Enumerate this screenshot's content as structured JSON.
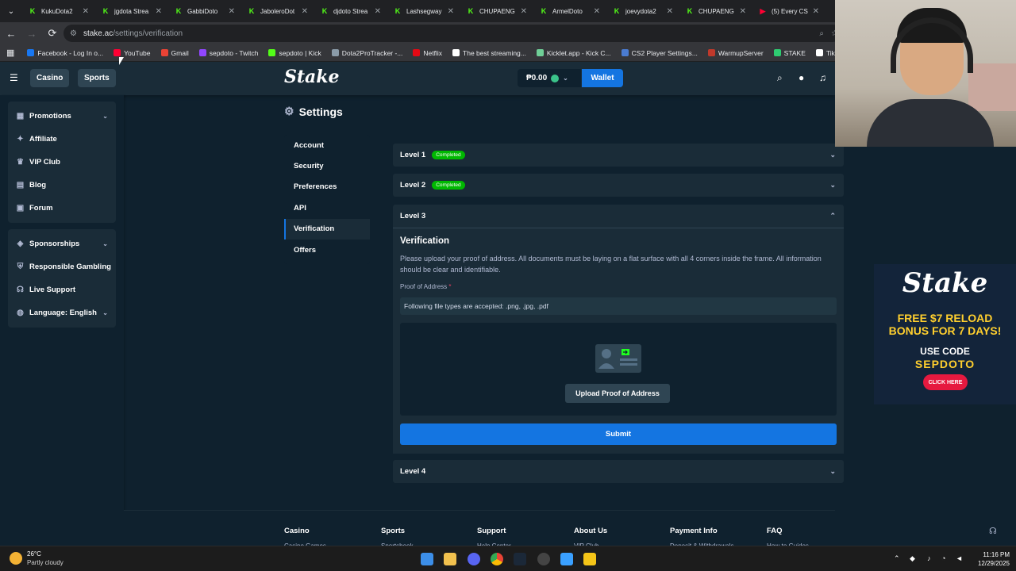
{
  "browser": {
    "tabs": [
      {
        "title": "KukuDota2",
        "color": "#53fc18"
      },
      {
        "title": "jgdota Strea",
        "color": "#53fc18"
      },
      {
        "title": "GabbiDoto",
        "color": "#53fc18"
      },
      {
        "title": "JaboleroDot",
        "color": "#53fc18"
      },
      {
        "title": "djdoto Strea",
        "color": "#53fc18"
      },
      {
        "title": "Lashsegway",
        "color": "#53fc18"
      },
      {
        "title": "CHUPAENG",
        "color": "#53fc18"
      },
      {
        "title": "ArmelDoto",
        "color": "#53fc18"
      },
      {
        "title": "joevydota2",
        "color": "#53fc18"
      },
      {
        "title": "CHUPAENG",
        "color": "#53fc18"
      },
      {
        "title": "(5) Every CS",
        "color": "#ff0033"
      }
    ],
    "url_host": "stake.ac",
    "url_path": "/settings/verification",
    "bookmarks": [
      {
        "label": "Facebook - Log In o...",
        "color": "#1877f2"
      },
      {
        "label": "YouTube",
        "color": "#ff0033"
      },
      {
        "label": "Gmail",
        "color": "#ea4335"
      },
      {
        "label": "sepdoto - Twitch",
        "color": "#9146ff"
      },
      {
        "label": "sepdoto | Kick",
        "color": "#53fc18"
      },
      {
        "label": "Dota2ProTracker -...",
        "color": "#8a9ba8"
      },
      {
        "label": "Netflix",
        "color": "#e50914"
      },
      {
        "label": "The best streaming...",
        "color": "#ffffff"
      },
      {
        "label": "Kicklet.app - Kick C...",
        "color": "#6fcf97"
      },
      {
        "label": "CS2 Player Settings...",
        "color": "#4a7bd0"
      },
      {
        "label": "WarmupServer",
        "color": "#c0392b"
      },
      {
        "label": "STAKE",
        "color": "#2ecc71"
      },
      {
        "label": "TikTok Studio",
        "color": "#ffffff"
      }
    ]
  },
  "header": {
    "casino": "Casino",
    "sports": "Sports",
    "logo": "Stake",
    "balance": "₱0.00",
    "wallet": "Wallet"
  },
  "sidebar": {
    "group1": [
      {
        "label": "Promotions",
        "icon": "gift-icon",
        "glyph": "▦",
        "chevron": true
      },
      {
        "label": "Affiliate",
        "icon": "affiliate-icon",
        "glyph": "✦",
        "chevron": false
      },
      {
        "label": "VIP Club",
        "icon": "trophy-icon",
        "glyph": "♛",
        "chevron": false
      },
      {
        "label": "Blog",
        "icon": "blog-icon",
        "glyph": "▤",
        "chevron": false
      },
      {
        "label": "Forum",
        "icon": "forum-icon",
        "glyph": "▣",
        "chevron": false
      }
    ],
    "group2": [
      {
        "label": "Sponsorships",
        "icon": "sponsorship-icon",
        "glyph": "◈",
        "chevron": true
      },
      {
        "label": "Responsible Gambling",
        "icon": "shield-icon",
        "glyph": "⛨",
        "chevron": false
      },
      {
        "label": "Live Support",
        "icon": "headset-icon",
        "glyph": "☊",
        "chevron": false
      },
      {
        "label": "Language: English",
        "icon": "globe-icon",
        "glyph": "◍",
        "chevron": true
      }
    ]
  },
  "settings": {
    "title": "Settings",
    "menu": [
      "Account",
      "Security",
      "Preferences",
      "API",
      "Verification",
      "Offers"
    ],
    "active": "Verification",
    "level1": "Level 1",
    "level2": "Level 2",
    "completed": "Completed",
    "level3": "Level 3",
    "level4": "Level 4",
    "verification_title": "Verification",
    "verification_desc": "Please upload your proof of address. All documents must be laying on a flat surface with all 4 corners inside the frame. All information should be clear and identifiable.",
    "poa_label": "Proof of Address",
    "required_mark": "*",
    "file_types": "Following file types are accepted: .png, .jpg, .pdf",
    "upload_button": "Upload Proof of Address",
    "submit_button": "Submit"
  },
  "footer": {
    "columns": [
      "Casino",
      "Sports",
      "Support",
      "About Us",
      "Payment Info",
      "FAQ"
    ],
    "subs": [
      "Casino Games",
      "Sportsbook",
      "Help Center",
      "VIP Club",
      "Deposit & Withdrawals",
      "How-to Guides"
    ]
  },
  "ad": {
    "logo": "Stake",
    "headline1": "FREE $7 RELOAD",
    "headline2": "BONUS FOR 7 DAYS!",
    "code_label": "USE CODE",
    "code": "SEPDOTO",
    "button": "CLICK HERE"
  },
  "taskbar": {
    "temp": "26°C",
    "weather": "Partly cloudy",
    "time": "11:16 PM",
    "date": "12/29/2025"
  }
}
